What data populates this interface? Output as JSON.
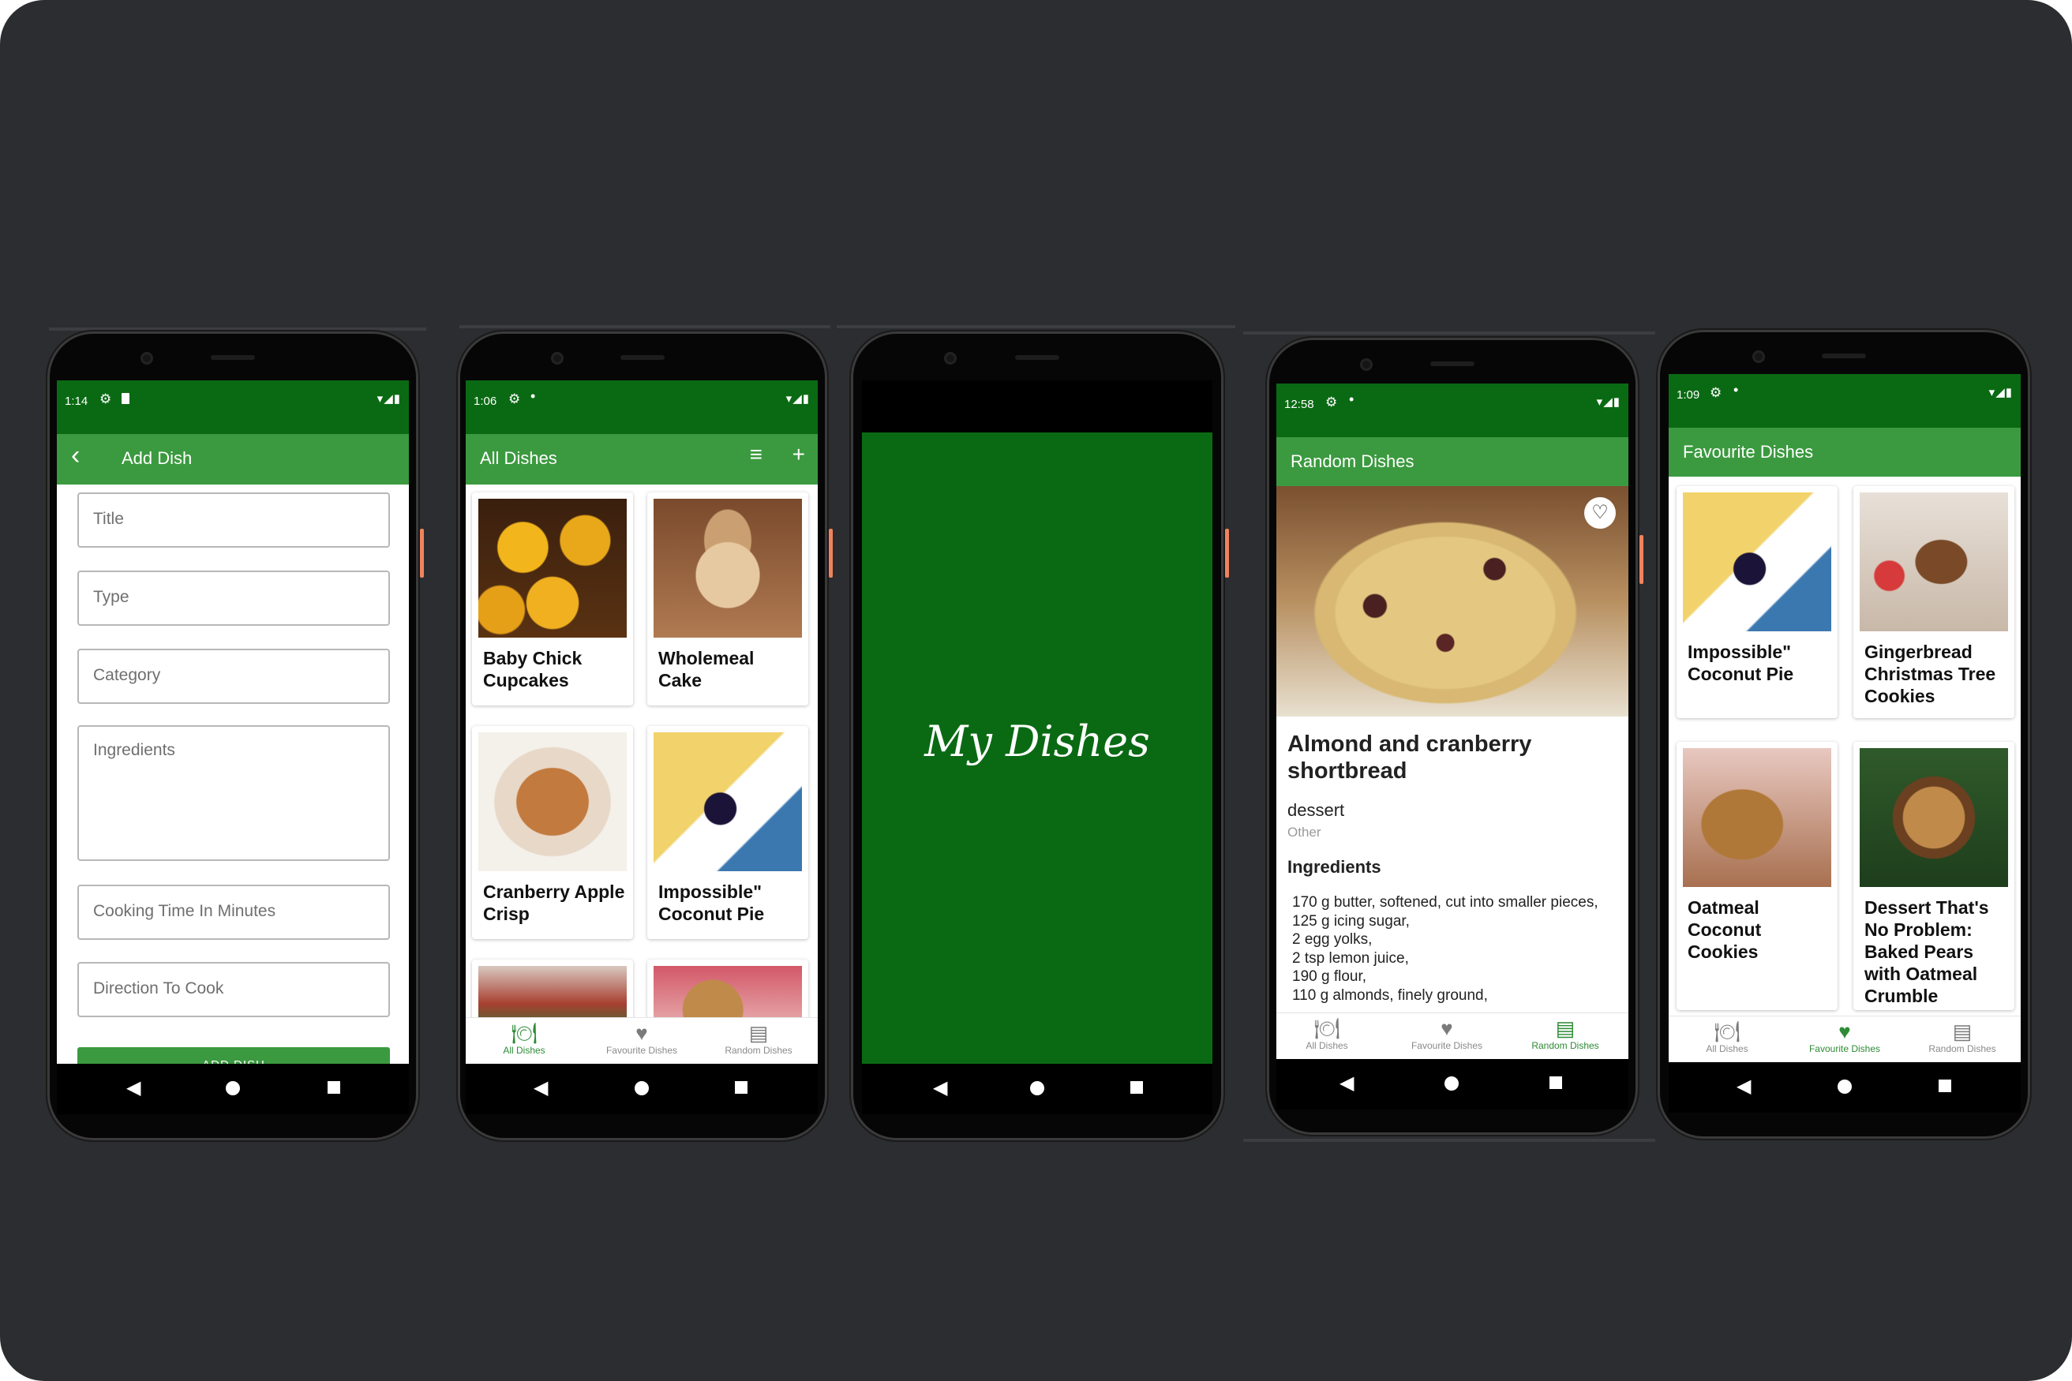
{
  "colors": {
    "status_green": "#0a6a13",
    "appbar_green": "#3b9a3f",
    "splash_green": "#0a6a13",
    "background": "#2c2d30"
  },
  "phone1": {
    "status_time": "1:14",
    "appbar_title": "Add Dish",
    "fields": {
      "title": "Title",
      "type": "Type",
      "category": "Category",
      "ingredients": "Ingredients",
      "cooking_time": "Cooking Time In Minutes",
      "direction": "Direction To Cook"
    },
    "add_button": "ADD DISH"
  },
  "phone2": {
    "status_time": "1:06",
    "appbar_title": "All Dishes",
    "cards": [
      {
        "label": "Baby Chick\nCupcakes"
      },
      {
        "label": "Wholemeal\nCake"
      },
      {
        "label": "Cranberry Apple\nCrisp"
      },
      {
        "label": "Impossible\"\nCoconut Pie"
      }
    ],
    "nav": {
      "all": "All Dishes",
      "fav": "Favourite Dishes",
      "random": "Random Dishes"
    }
  },
  "phone3": {
    "splash_title": "My Dishes"
  },
  "phone4": {
    "status_time": "12:58",
    "appbar_title": "Random Dishes",
    "dish_title": "Almond and cranberry shortbread",
    "dish_type": "dessert",
    "dish_category": "Other",
    "ingredients_heading": "Ingredients",
    "ingredients_text": "170 g butter, softened, cut into smaller pieces,\n125 g icing sugar,\n2 egg yolks,\n2 tsp lemon juice,\n190 g flour,\n110 g almonds, finely ground,",
    "nav": {
      "all": "All Dishes",
      "fav": "Favourite Dishes",
      "random": "Random Dishes"
    }
  },
  "phone5": {
    "status_time": "1:09",
    "appbar_title": "Favourite Dishes",
    "cards": [
      {
        "label": "Impossible\"\nCoconut Pie"
      },
      {
        "label": "Gingerbread\nChristmas Tree\nCookies"
      },
      {
        "label": "Oatmeal\nCoconut\nCookies"
      },
      {
        "label": "Dessert That's\nNo Problem:\nBaked Pears\nwith Oatmeal\nCrumble"
      }
    ],
    "nav": {
      "all": "All Dishes",
      "fav": "Favourite Dishes",
      "random": "Random Dishes"
    }
  },
  "icons": {
    "gear": "⚙",
    "back_arrow": "‹",
    "filter": "≡",
    "add": "+",
    "heart": "♡",
    "nav_back": "◀",
    "wifi_signal_battery": "▾◢▮",
    "all_dishes": "🍽",
    "favourite": "♥",
    "random": "▤"
  }
}
